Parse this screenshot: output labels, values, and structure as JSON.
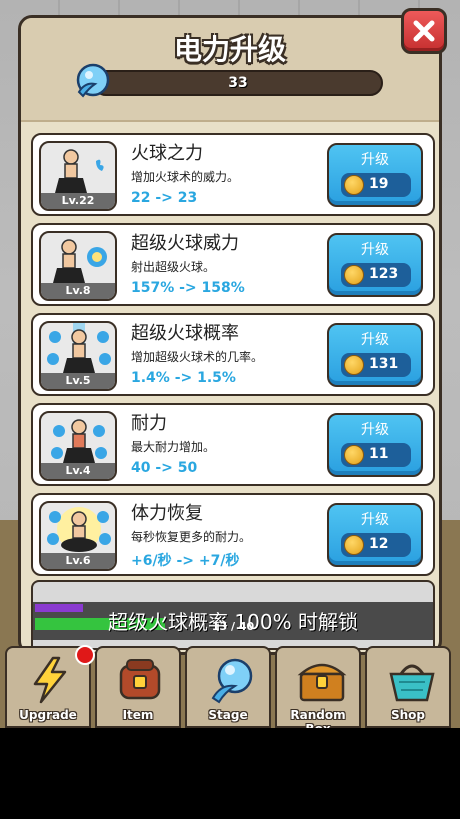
{
  "panel": {
    "title": "电力升级",
    "power_value": "33"
  },
  "upgrades": [
    {
      "name": "火球之力",
      "desc": "增加火球术的威力。",
      "stat": "22 -> 23",
      "level": "Lv.22",
      "button_label": "升级",
      "cost": "19"
    },
    {
      "name": "超级火球威力",
      "desc": "射出超级火球。",
      "stat": "157% -> 158%",
      "level": "Lv.8",
      "button_label": "升级",
      "cost": "123"
    },
    {
      "name": "超级火球概率",
      "desc": "增加超级火球术的几率。",
      "stat": "1.4% -> 1.5%",
      "level": "Lv.5",
      "button_label": "升级",
      "cost": "131"
    },
    {
      "name": "耐力",
      "desc": "最大耐力增加。",
      "stat": "40 -> 50",
      "level": "Lv.4",
      "button_label": "升级",
      "cost": "11"
    },
    {
      "name": "体力恢复",
      "desc": "每秒恢复更多的耐力。",
      "stat": "+6/秒 -> +7/秒",
      "level": "Lv.6",
      "button_label": "升级",
      "cost": "12"
    }
  ],
  "progress": {
    "unlock_text": "超级火球概率 100% 时解锁",
    "count": "13 / 40",
    "fraction": 0.325
  },
  "nav": {
    "tabs": [
      {
        "label": "Upgrade",
        "icon": "lightning-icon"
      },
      {
        "label": "Item",
        "icon": "backpack-icon"
      },
      {
        "label": "Stage",
        "icon": "energy-orb-icon"
      },
      {
        "label": "Random Box",
        "icon": "treasure-chest-icon"
      },
      {
        "label": "Shop",
        "icon": "shopping-basket-icon"
      }
    ]
  },
  "colors": {
    "accent_blue": "#2aa7e0",
    "close_red": "#d63a3a",
    "progress_green": "#35c43f",
    "progress_purple": "#8a3ad0"
  }
}
